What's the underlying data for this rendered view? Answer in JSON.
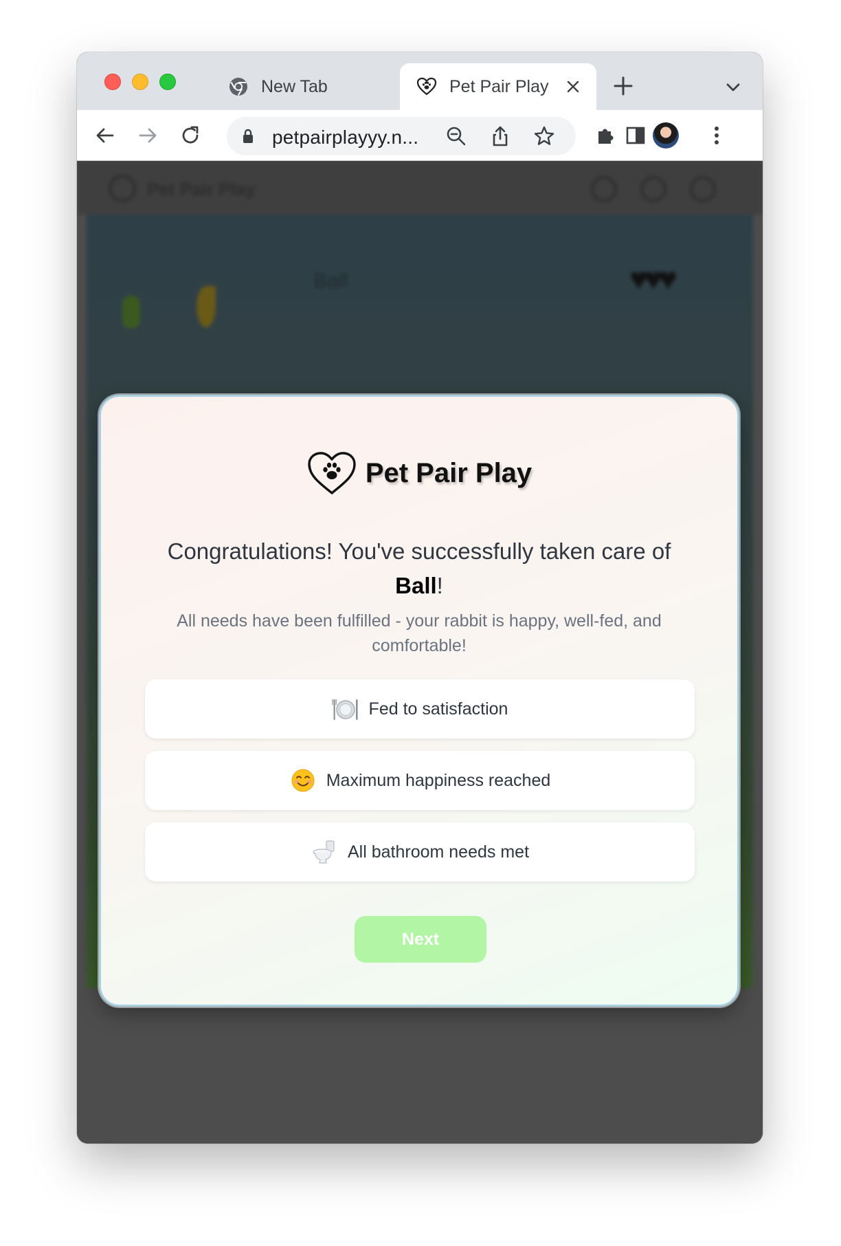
{
  "browser": {
    "tabs": [
      {
        "title": "New Tab",
        "icon": "chrome-icon",
        "active": false
      },
      {
        "title": "Pet Pair Play",
        "icon": "paw-heart-icon",
        "active": true
      }
    ],
    "url": "petpairplayyy.n..."
  },
  "background": {
    "brand": "Pet Pair Play",
    "pet_name": "Ball",
    "hearts": "♥♥♥"
  },
  "modal": {
    "brand": "Pet Pair Play",
    "congrats_prefix": "Congratulations! You've successfully taken care of ",
    "pet_name": "Ball",
    "congrats_suffix": "!",
    "subtext": "All needs have been fulfilled - your rabbit is happy, well-fed, and comfortable!",
    "achievements": [
      {
        "icon": "plate-icon",
        "text": "Fed to satisfaction"
      },
      {
        "icon": "smile-icon",
        "text": "Maximum happiness reached"
      },
      {
        "icon": "toilet-icon",
        "text": "All bathroom needs met"
      }
    ],
    "next_label": "Next",
    "next_color": "#b2f5a4"
  }
}
